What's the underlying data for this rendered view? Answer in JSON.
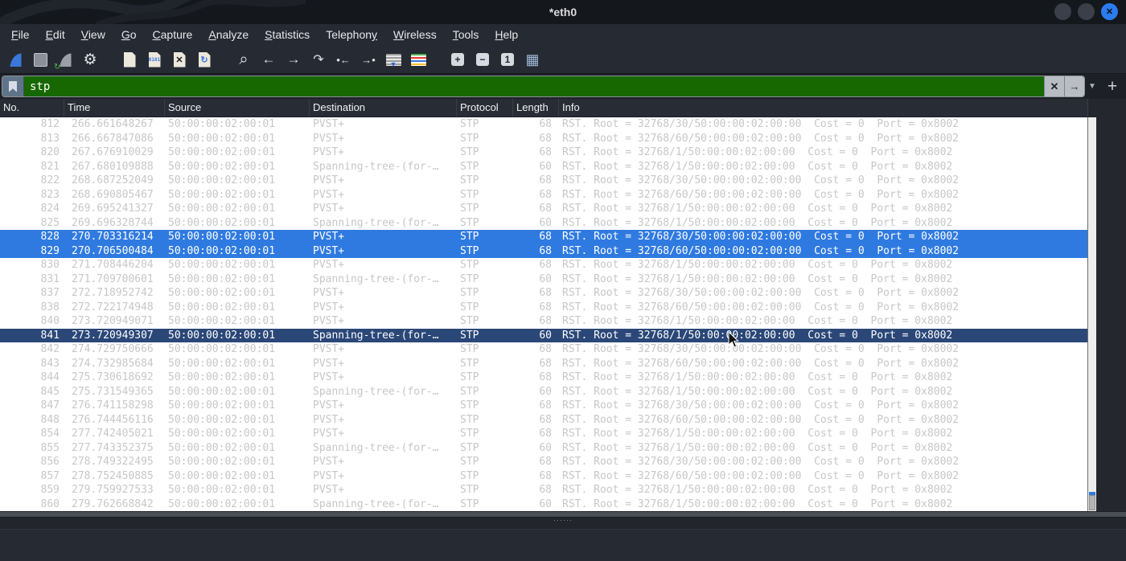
{
  "window": {
    "title": "*eth0",
    "close_glyph": "✕"
  },
  "menubar": {
    "items": [
      {
        "label": "File",
        "underline": 0
      },
      {
        "label": "Edit",
        "underline": 0
      },
      {
        "label": "View",
        "underline": 0
      },
      {
        "label": "Go",
        "underline": 0
      },
      {
        "label": "Capture",
        "underline": 0
      },
      {
        "label": "Analyze",
        "underline": 0
      },
      {
        "label": "Statistics",
        "underline": 0
      },
      {
        "label": "Telephony",
        "underline": 8
      },
      {
        "label": "Wireless",
        "underline": 0
      },
      {
        "label": "Tools",
        "underline": 0
      },
      {
        "label": "Help",
        "underline": 0
      }
    ]
  },
  "toolbar": {
    "buttons": [
      {
        "name": "start-capture-button",
        "kind": "fin",
        "color": "#3b77d9"
      },
      {
        "name": "stop-capture-button",
        "kind": "square",
        "color": "#8a8f98"
      },
      {
        "name": "restart-capture-button",
        "kind": "fin",
        "color": "#9aa0a8",
        "badge": "↻"
      },
      {
        "name": "capture-options-button",
        "kind": "glyph",
        "glyph": "⚙",
        "size": 19
      },
      {
        "name": "open-file-button",
        "kind": "file",
        "overlay": "",
        "gap": true
      },
      {
        "name": "save-file-button",
        "kind": "file",
        "overlay": "0101",
        "overlay_color": "#3b77d9"
      },
      {
        "name": "close-file-button",
        "kind": "file",
        "overlay": "✕",
        "overlay_color": "#1a1a1a"
      },
      {
        "name": "reload-file-button",
        "kind": "file",
        "overlay": "↻",
        "overlay_color": "#3b77d9"
      },
      {
        "name": "find-packet-button",
        "kind": "glyph",
        "glyph": "⌕",
        "size": 20,
        "gap": true
      },
      {
        "name": "go-back-button",
        "kind": "glyph",
        "glyph": "←",
        "size": 17
      },
      {
        "name": "go-forward-button",
        "kind": "glyph",
        "glyph": "→",
        "size": 17
      },
      {
        "name": "go-to-packet-button",
        "kind": "glyph",
        "glyph": "↷",
        "size": 16
      },
      {
        "name": "previous-packet-button",
        "kind": "glyph",
        "glyph": "•←",
        "size": 13
      },
      {
        "name": "next-packet-button",
        "kind": "glyph",
        "glyph": "→•",
        "size": 13
      },
      {
        "name": "autoscroll-button",
        "kind": "list",
        "variant": "autoscroll",
        "arrow": "▼"
      },
      {
        "name": "colorize-button",
        "kind": "list",
        "variant": "colorize"
      },
      {
        "name": "zoom-in-button",
        "kind": "box",
        "glyph": "+",
        "gap": true
      },
      {
        "name": "zoom-out-button",
        "kind": "box",
        "glyph": "−"
      },
      {
        "name": "zoom-100-button",
        "kind": "box",
        "glyph": "1"
      },
      {
        "name": "resize-columns-button",
        "kind": "glyph",
        "glyph": "▦",
        "size": 18,
        "color": "#9fb8d8"
      }
    ]
  },
  "filter_bar": {
    "value": "stp",
    "clear_glyph": "✕",
    "apply_glyph": "→",
    "caret_glyph": "▼",
    "add_glyph": "+"
  },
  "packet_list": {
    "columns": [
      "No.",
      "Time",
      "Source",
      "Destination",
      "Protocol",
      "Length",
      "Info"
    ],
    "rows": [
      {
        "no": "812",
        "time": "266.661648267",
        "source": "50:00:00:02:00:01",
        "destination": "PVST+",
        "protocol": "STP",
        "length": "68",
        "info": "RST. Root = 32768/30/50:00:00:02:00:00  Cost = 0  Port = 0x8002",
        "state": "normal"
      },
      {
        "no": "813",
        "time": "266.667847086",
        "source": "50:00:00:02:00:01",
        "destination": "PVST+",
        "protocol": "STP",
        "length": "68",
        "info": "RST. Root = 32768/60/50:00:00:02:00:00  Cost = 0  Port = 0x8002",
        "state": "normal"
      },
      {
        "no": "820",
        "time": "267.676910029",
        "source": "50:00:00:02:00:01",
        "destination": "PVST+",
        "protocol": "STP",
        "length": "68",
        "info": "RST. Root = 32768/1/50:00:00:02:00:00  Cost = 0  Port = 0x8002",
        "state": "normal"
      },
      {
        "no": "821",
        "time": "267.680109888",
        "source": "50:00:00:02:00:01",
        "destination": "Spanning-tree-(for-…",
        "protocol": "STP",
        "length": "60",
        "info": "RST. Root = 32768/1/50:00:00:02:00:00  Cost = 0  Port = 0x8002",
        "state": "normal"
      },
      {
        "no": "822",
        "time": "268.687252049",
        "source": "50:00:00:02:00:01",
        "destination": "PVST+",
        "protocol": "STP",
        "length": "68",
        "info": "RST. Root = 32768/30/50:00:00:02:00:00  Cost = 0  Port = 0x8002",
        "state": "normal"
      },
      {
        "no": "823",
        "time": "268.690805467",
        "source": "50:00:00:02:00:01",
        "destination": "PVST+",
        "protocol": "STP",
        "length": "68",
        "info": "RST. Root = 32768/60/50:00:00:02:00:00  Cost = 0  Port = 0x8002",
        "state": "normal"
      },
      {
        "no": "824",
        "time": "269.695241327",
        "source": "50:00:00:02:00:01",
        "destination": "PVST+",
        "protocol": "STP",
        "length": "68",
        "info": "RST. Root = 32768/1/50:00:00:02:00:00  Cost = 0  Port = 0x8002",
        "state": "normal"
      },
      {
        "no": "825",
        "time": "269.696328744",
        "source": "50:00:00:02:00:01",
        "destination": "Spanning-tree-(for-…",
        "protocol": "STP",
        "length": "60",
        "info": "RST. Root = 32768/1/50:00:00:02:00:00  Cost = 0  Port = 0x8002",
        "state": "normal"
      },
      {
        "no": "828",
        "time": "270.703316214",
        "source": "50:00:00:02:00:01",
        "destination": "PVST+",
        "protocol": "STP",
        "length": "68",
        "info": "RST. Root = 32768/30/50:00:00:02:00:00  Cost = 0  Port = 0x8002",
        "state": "selected"
      },
      {
        "no": "829",
        "time": "270.706500484",
        "source": "50:00:00:02:00:01",
        "destination": "PVST+",
        "protocol": "STP",
        "length": "68",
        "info": "RST. Root = 32768/60/50:00:00:02:00:00  Cost = 0  Port = 0x8002",
        "state": "selected"
      },
      {
        "no": "830",
        "time": "271.708446204",
        "source": "50:00:00:02:00:01",
        "destination": "PVST+",
        "protocol": "STP",
        "length": "68",
        "info": "RST. Root = 32768/1/50:00:00:02:00:00  Cost = 0  Port = 0x8002",
        "state": "normal"
      },
      {
        "no": "831",
        "time": "271.709700601",
        "source": "50:00:00:02:00:01",
        "destination": "Spanning-tree-(for-…",
        "protocol": "STP",
        "length": "60",
        "info": "RST. Root = 32768/1/50:00:00:02:00:00  Cost = 0  Port = 0x8002",
        "state": "normal"
      },
      {
        "no": "837",
        "time": "272.718952742",
        "source": "50:00:00:02:00:01",
        "destination": "PVST+",
        "protocol": "STP",
        "length": "68",
        "info": "RST. Root = 32768/30/50:00:00:02:00:00  Cost = 0  Port = 0x8002",
        "state": "normal"
      },
      {
        "no": "838",
        "time": "272.722174948",
        "source": "50:00:00:02:00:01",
        "destination": "PVST+",
        "protocol": "STP",
        "length": "68",
        "info": "RST. Root = 32768/60/50:00:00:02:00:00  Cost = 0  Port = 0x8002",
        "state": "normal"
      },
      {
        "no": "840",
        "time": "273.720949071",
        "source": "50:00:00:02:00:01",
        "destination": "PVST+",
        "protocol": "STP",
        "length": "68",
        "info": "RST. Root = 32768/1/50:00:00:02:00:00  Cost = 0  Port = 0x8002",
        "state": "normal"
      },
      {
        "no": "841",
        "time": "273.720949307",
        "source": "50:00:00:02:00:01",
        "destination": "Spanning-tree-(for-…",
        "protocol": "STP",
        "length": "60",
        "info": "RST. Root = 32768/1/50:00:00:02:00:00  Cost = 0  Port = 0x8002",
        "state": "current"
      },
      {
        "no": "842",
        "time": "274.729750666",
        "source": "50:00:00:02:00:01",
        "destination": "PVST+",
        "protocol": "STP",
        "length": "68",
        "info": "RST. Root = 32768/30/50:00:00:02:00:00  Cost = 0  Port = 0x8002",
        "state": "normal"
      },
      {
        "no": "843",
        "time": "274.732985684",
        "source": "50:00:00:02:00:01",
        "destination": "PVST+",
        "protocol": "STP",
        "length": "68",
        "info": "RST. Root = 32768/60/50:00:00:02:00:00  Cost = 0  Port = 0x8002",
        "state": "normal"
      },
      {
        "no": "844",
        "time": "275.730618692",
        "source": "50:00:00:02:00:01",
        "destination": "PVST+",
        "protocol": "STP",
        "length": "68",
        "info": "RST. Root = 32768/1/50:00:00:02:00:00  Cost = 0  Port = 0x8002",
        "state": "normal"
      },
      {
        "no": "845",
        "time": "275.731549365",
        "source": "50:00:00:02:00:01",
        "destination": "Spanning-tree-(for-…",
        "protocol": "STP",
        "length": "60",
        "info": "RST. Root = 32768/1/50:00:00:02:00:00  Cost = 0  Port = 0x8002",
        "state": "normal"
      },
      {
        "no": "847",
        "time": "276.741158298",
        "source": "50:00:00:02:00:01",
        "destination": "PVST+",
        "protocol": "STP",
        "length": "68",
        "info": "RST. Root = 32768/30/50:00:00:02:00:00  Cost = 0  Port = 0x8002",
        "state": "normal"
      },
      {
        "no": "848",
        "time": "276.744456116",
        "source": "50:00:00:02:00:01",
        "destination": "PVST+",
        "protocol": "STP",
        "length": "68",
        "info": "RST. Root = 32768/60/50:00:00:02:00:00  Cost = 0  Port = 0x8002",
        "state": "normal"
      },
      {
        "no": "854",
        "time": "277.742405021",
        "source": "50:00:00:02:00:01",
        "destination": "PVST+",
        "protocol": "STP",
        "length": "68",
        "info": "RST. Root = 32768/1/50:00:00:02:00:00  Cost = 0  Port = 0x8002",
        "state": "normal"
      },
      {
        "no": "855",
        "time": "277.743352375",
        "source": "50:00:00:02:00:01",
        "destination": "Spanning-tree-(for-…",
        "protocol": "STP",
        "length": "60",
        "info": "RST. Root = 32768/1/50:00:00:02:00:00  Cost = 0  Port = 0x8002",
        "state": "normal"
      },
      {
        "no": "856",
        "time": "278.749322495",
        "source": "50:00:00:02:00:01",
        "destination": "PVST+",
        "protocol": "STP",
        "length": "68",
        "info": "RST. Root = 32768/30/50:00:00:02:00:00  Cost = 0  Port = 0x8002",
        "state": "normal"
      },
      {
        "no": "857",
        "time": "278.752450885",
        "source": "50:00:00:02:00:01",
        "destination": "PVST+",
        "protocol": "STP",
        "length": "68",
        "info": "RST. Root = 32768/60/50:00:00:02:00:00  Cost = 0  Port = 0x8002",
        "state": "normal"
      },
      {
        "no": "859",
        "time": "279.759927533",
        "source": "50:00:00:02:00:01",
        "destination": "PVST+",
        "protocol": "STP",
        "length": "68",
        "info": "RST. Root = 32768/1/50:00:00:02:00:00  Cost = 0  Port = 0x8002",
        "state": "normal"
      },
      {
        "no": "860",
        "time": "279.762668842",
        "source": "50:00:00:02:00:01",
        "destination": "Spanning-tree-(for-…",
        "protocol": "STP",
        "length": "60",
        "info": "RST. Root = 32768/1/50:00:00:02:00:00  Cost = 0  Port = 0x8002",
        "state": "normal"
      }
    ]
  },
  "splitter": {
    "handle_dots": "······"
  },
  "colors": {
    "accent_blue": "#3b77d9",
    "selected_row_bg": "#2f7ae0",
    "current_row_bg": "#2b4778",
    "filter_valid_bg": "#176800",
    "row_text": "#c7c7c7",
    "titlebar_bg": "#14171c",
    "chrome_bg": "#262a33",
    "close_button_bg": "#2b7cf0"
  }
}
